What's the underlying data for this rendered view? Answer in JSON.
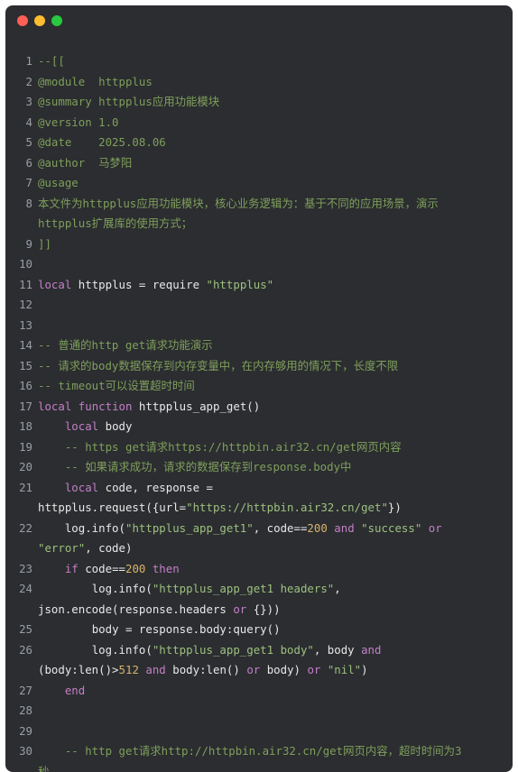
{
  "window": {
    "controls": [
      "close",
      "minimize",
      "zoom"
    ]
  },
  "code": {
    "lines": [
      {
        "n": "1",
        "parts": [
          [
            "c",
            "--[["
          ]
        ]
      },
      {
        "n": "2",
        "parts": [
          [
            "c",
            "@module  httpplus"
          ]
        ]
      },
      {
        "n": "3",
        "parts": [
          [
            "c",
            "@summary httpplus应用功能模块"
          ]
        ]
      },
      {
        "n": "4",
        "parts": [
          [
            "c",
            "@version 1.0"
          ]
        ]
      },
      {
        "n": "5",
        "parts": [
          [
            "c",
            "@date    2025.08.06"
          ]
        ]
      },
      {
        "n": "6",
        "parts": [
          [
            "c",
            "@author  马梦阳"
          ]
        ]
      },
      {
        "n": "7",
        "parts": [
          [
            "c",
            "@usage"
          ]
        ]
      },
      {
        "n": "8",
        "parts": [
          [
            "c",
            "本文件为httpplus应用功能模块，核心业务逻辑为：基于不同的应用场景，演示"
          ]
        ]
      },
      {
        "n": "",
        "parts": [
          [
            "c",
            "httpplus扩展库的使用方式；"
          ]
        ]
      },
      {
        "n": "9",
        "parts": [
          [
            "c",
            "]]"
          ]
        ]
      },
      {
        "n": "10",
        "parts": []
      },
      {
        "n": "11",
        "parts": [
          [
            "k",
            "local"
          ],
          [
            "p",
            " httpplus = require "
          ],
          [
            "s",
            "\"httpplus\""
          ]
        ]
      },
      {
        "n": "12",
        "parts": []
      },
      {
        "n": "13",
        "parts": []
      },
      {
        "n": "14",
        "parts": [
          [
            "c",
            "-- 普通的http get请求功能演示"
          ]
        ]
      },
      {
        "n": "15",
        "parts": [
          [
            "c",
            "-- 请求的body数据保存到内存变量中，在内存够用的情况下，长度不限"
          ]
        ]
      },
      {
        "n": "16",
        "parts": [
          [
            "c",
            "-- timeout可以设置超时时间"
          ]
        ]
      },
      {
        "n": "17",
        "parts": [
          [
            "k",
            "local"
          ],
          [
            "p",
            " "
          ],
          [
            "k",
            "function"
          ],
          [
            "p",
            " httpplus_app_get()"
          ]
        ]
      },
      {
        "n": "18",
        "parts": [
          [
            "p",
            "    "
          ],
          [
            "k",
            "local"
          ],
          [
            "p",
            " body"
          ]
        ]
      },
      {
        "n": "19",
        "parts": [
          [
            "c",
            "    -- https get请求https://httpbin.air32.cn/get网页内容"
          ]
        ]
      },
      {
        "n": "20",
        "parts": [
          [
            "c",
            "    -- 如果请求成功，请求的数据保存到response.body中"
          ]
        ]
      },
      {
        "n": "21",
        "parts": [
          [
            "p",
            "    "
          ],
          [
            "k",
            "local"
          ],
          [
            "p",
            " code, response ="
          ]
        ]
      },
      {
        "n": "",
        "parts": [
          [
            "p",
            "httpplus.request({url="
          ],
          [
            "s",
            "\"https://httpbin.air32.cn/get\""
          ],
          [
            "p",
            "})"
          ]
        ]
      },
      {
        "n": "22",
        "parts": [
          [
            "p",
            "    log.info("
          ],
          [
            "s",
            "\"httpplus_app_get1\""
          ],
          [
            "p",
            ", code=="
          ],
          [
            "n",
            "200"
          ],
          [
            "p",
            " "
          ],
          [
            "k",
            "and"
          ],
          [
            "p",
            " "
          ],
          [
            "s",
            "\"success\""
          ],
          [
            "p",
            " "
          ],
          [
            "k",
            "or"
          ]
        ]
      },
      {
        "n": "",
        "parts": [
          [
            "s",
            "\"error\""
          ],
          [
            "p",
            ", code)"
          ]
        ]
      },
      {
        "n": "23",
        "parts": [
          [
            "p",
            "    "
          ],
          [
            "k",
            "if"
          ],
          [
            "p",
            " code=="
          ],
          [
            "n",
            "200"
          ],
          [
            "p",
            " "
          ],
          [
            "k",
            "then"
          ]
        ]
      },
      {
        "n": "24",
        "parts": [
          [
            "p",
            "        log.info("
          ],
          [
            "s",
            "\"httpplus_app_get1 headers\""
          ],
          [
            "p",
            ","
          ]
        ]
      },
      {
        "n": "",
        "parts": [
          [
            "p",
            "json.encode(response.headers "
          ],
          [
            "k",
            "or"
          ],
          [
            "p",
            " {}))"
          ]
        ]
      },
      {
        "n": "25",
        "parts": [
          [
            "p",
            "        body = response.body:query()"
          ]
        ]
      },
      {
        "n": "26",
        "parts": [
          [
            "p",
            "        log.info("
          ],
          [
            "s",
            "\"httpplus_app_get1 body\""
          ],
          [
            "p",
            ", body "
          ],
          [
            "k",
            "and"
          ]
        ]
      },
      {
        "n": "",
        "parts": [
          [
            "p",
            "(body:len()>"
          ],
          [
            "n",
            "512"
          ],
          [
            "p",
            " "
          ],
          [
            "k",
            "and"
          ],
          [
            "p",
            " body:len() "
          ],
          [
            "k",
            "or"
          ],
          [
            "p",
            " body) "
          ],
          [
            "k",
            "or"
          ],
          [
            "p",
            " "
          ],
          [
            "s",
            "\"nil\""
          ],
          [
            "p",
            ")"
          ]
        ]
      },
      {
        "n": "27",
        "parts": [
          [
            "p",
            "    "
          ],
          [
            "k",
            "end"
          ]
        ]
      },
      {
        "n": "28",
        "parts": []
      },
      {
        "n": "29",
        "parts": []
      },
      {
        "n": "30",
        "parts": [
          [
            "c",
            "    -- http get请求http://httpbin.air32.cn/get网页内容，超时时间为3"
          ]
        ]
      },
      {
        "n": "",
        "parts": [
          [
            "c",
            "秒"
          ]
        ]
      }
    ]
  }
}
